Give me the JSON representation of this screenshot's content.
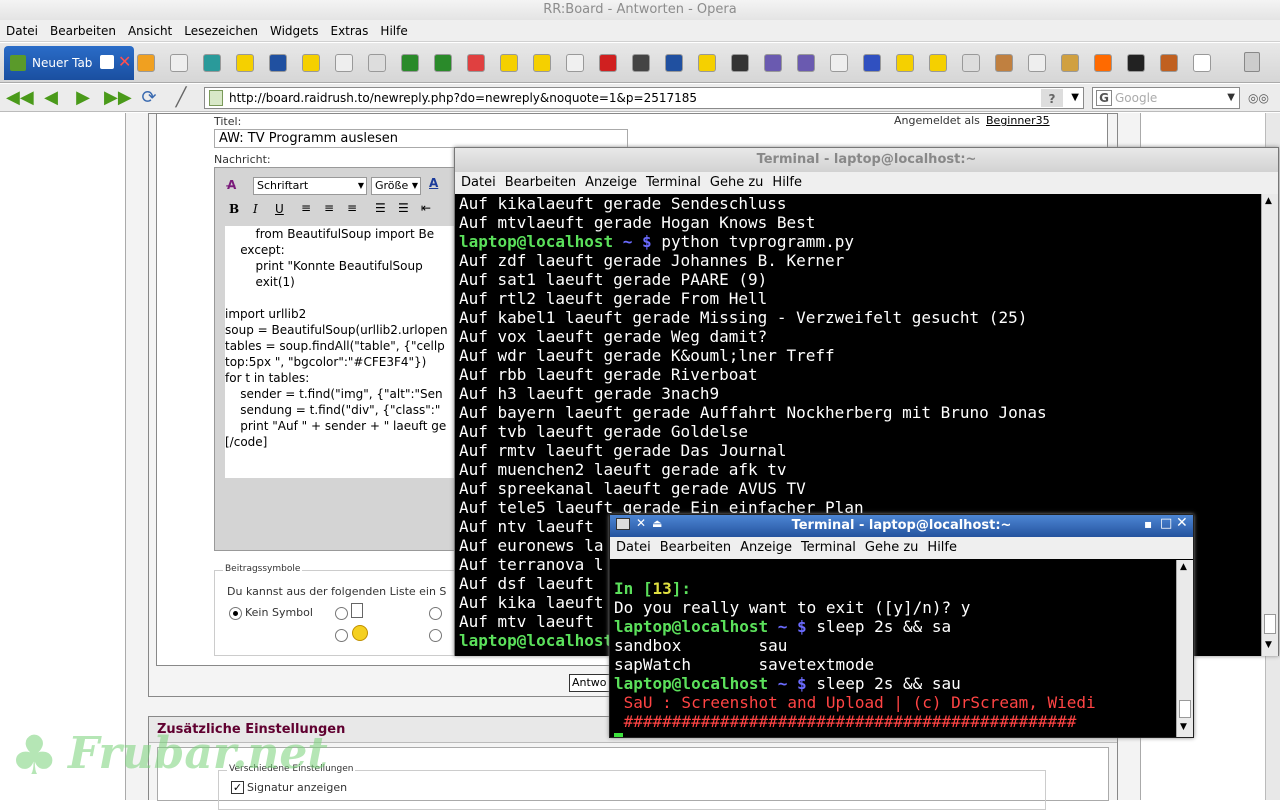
{
  "window": {
    "title": "RR:Board - Antworten - Opera"
  },
  "menu": [
    "Datei",
    "Bearbeiten",
    "Ansicht",
    "Lesezeichen",
    "Widgets",
    "Extras",
    "Hilfe"
  ],
  "tabs": {
    "active_label": "Neuer Tab"
  },
  "address": {
    "url": "http://board.raidrush.to/newreply.php?do=newreply&noquote=1&p=2517185",
    "search_placeholder": "Google"
  },
  "form": {
    "title_label": "Titel:",
    "title_value": "AW: TV Programm auslesen",
    "logged_in_label": "Angemeldet als",
    "username": "Beginner35",
    "message_label": "Nachricht:",
    "font_select": "Schriftart",
    "size_select": "Größe",
    "editor_lines": [
      "        from BeautifulSoup import Be",
      "    except:",
      "        print \"Konnte BeautifulSoup",
      "        exit(1)",
      "",
      "import urllib2",
      "soup = BeautifulSoup(urllib2.urlopen",
      "tables = soup.findAll(\"table\", {\"cellp",
      "top:5px \", \"bgcolor\":\"#CFE3F4\"})",
      "for t in tables:",
      "    sender = t.find(\"img\", {\"alt\":\"Sen",
      "    sendung = t.find(\"div\", {\"class\":\"",
      "    print \"Auf \" + sender + \" laeuft ge",
      "[/code]"
    ],
    "symbols_legend": "Beitragssymbole",
    "symbols_hint": "Du kannst aus der folgenden Liste ein S",
    "no_symbol": "Kein Symbol",
    "submit_partial": "Antwo",
    "extra_settings": "Zusätzliche Einstellungen",
    "misc_settings": "Verschiedene Einstellungen",
    "signature_label": "Signatur anzeigen"
  },
  "terminal1": {
    "title": "Terminal - laptop@localhost:~",
    "menu": [
      "Datei",
      "Bearbeiten",
      "Anzeige",
      "Terminal",
      "Gehe zu",
      "Hilfe"
    ],
    "lines": [
      "Auf kikalaeuft gerade Sendeschluss",
      "Auf mtvlaeuft gerade Hogan Knows Best",
      "Auf zdf laeuft gerade Johannes B. Kerner",
      "Auf sat1 laeuft gerade PAARE (9)",
      "Auf rtl2 laeuft gerade From Hell",
      "Auf kabel1 laeuft gerade Missing - Verzweifelt gesucht (25)",
      "Auf vox laeuft gerade Weg damit?",
      "Auf wdr laeuft gerade K&ouml;lner Treff",
      "Auf rbb laeuft gerade Riverboat",
      "Auf h3 laeuft gerade 3nach9",
      "Auf bayern laeuft gerade Auffahrt Nockherberg mit Bruno Jonas",
      "Auf tvb laeuft gerade Goldelse",
      "Auf rmtv laeuft gerade Das Journal",
      "Auf muenchen2 laeuft gerade afk tv",
      "Auf spreekanal laeuft gerade AVUS TV",
      "Auf tele5 laeuft gerade Ein einfacher Plan",
      "Auf ntv laeuft",
      "Auf euronews la",
      "Auf terranova l",
      "Auf dsf laeuft",
      "Auf kika laeuft",
      "Auf mtv laeuft"
    ],
    "prompt_user": "laptop@localhost",
    "prompt_path": "~ $",
    "command": "python tvprogramm.py"
  },
  "terminal2": {
    "title": "Terminal - laptop@localhost:~",
    "menu": [
      "Datei",
      "Bearbeiten",
      "Anzeige",
      "Terminal",
      "Gehe zu",
      "Hilfe"
    ],
    "in_prefix": "In [",
    "in_num": "13",
    "in_suffix": "]:",
    "exit_question": "Do you really want to exit ([y]/n)? y",
    "cmd1": "sleep 2s && sa",
    "completion1": "sandbox        sau",
    "completion2": "sapWatch       savetextmode",
    "cmd2": "sleep 2s && sau",
    "sau_banner": " SaU : Screenshot and Upload | (c) DrScream, Wiedi",
    "hashes": " ###############################################"
  },
  "watermark": "Frubar.net",
  "colors": {
    "prompt_green": "#5be05b",
    "prompt_blue": "#6b6bff",
    "sau_red": "#ff4444",
    "tab_blue": "#1a4fa0",
    "form_header": "#600030"
  }
}
